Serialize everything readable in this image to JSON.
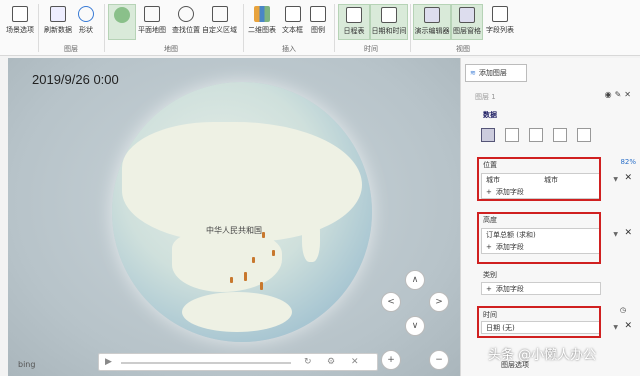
{
  "ribbon": {
    "buttons": [
      {
        "label": "场景选项"
      },
      {
        "label": "刷新数据"
      },
      {
        "label": "形状"
      },
      {
        "label": "平面地图"
      },
      {
        "label": "查找位置"
      },
      {
        "label": "自定义区域"
      },
      {
        "label": "二维图表"
      },
      {
        "label": "文本框"
      },
      {
        "label": "图例"
      },
      {
        "label": "日程表"
      },
      {
        "label": "日期和时间"
      },
      {
        "label": "演示编辑器"
      },
      {
        "label": "图层窗格"
      },
      {
        "label": "字段列表"
      }
    ],
    "groups": {
      "layer": "图层",
      "map": "地图",
      "insert": "插入",
      "time": "时间",
      "view": "视图"
    }
  },
  "map": {
    "timestamp": "2019/9/26 0:00",
    "country_label": "中华人民共和国",
    "bing": "bing",
    "nav": {
      "up": "∧",
      "left": "<",
      "right": ">",
      "down": "∨",
      "plus": "+",
      "minus": "−"
    }
  },
  "panel": {
    "add_layer": "添加图层",
    "layer_name": "图层 1",
    "data_title": "数据",
    "percent": "82%",
    "position": {
      "title": "位置",
      "field": "城市",
      "type": "城市",
      "add": "添加字段"
    },
    "height": {
      "title": "高度",
      "field": "订单总额 (求和)",
      "add": "添加字段"
    },
    "category": {
      "title": "类别",
      "add": "添加字段"
    },
    "time": {
      "title": "时间",
      "field": "日期 (无)"
    },
    "layer_options": "图层选项"
  },
  "watermark": "头条 @小懒人办公",
  "colors": {
    "highlight": "#d02020",
    "ribbon_selected": "#d9ead9",
    "accent": "#2a6fc9"
  }
}
